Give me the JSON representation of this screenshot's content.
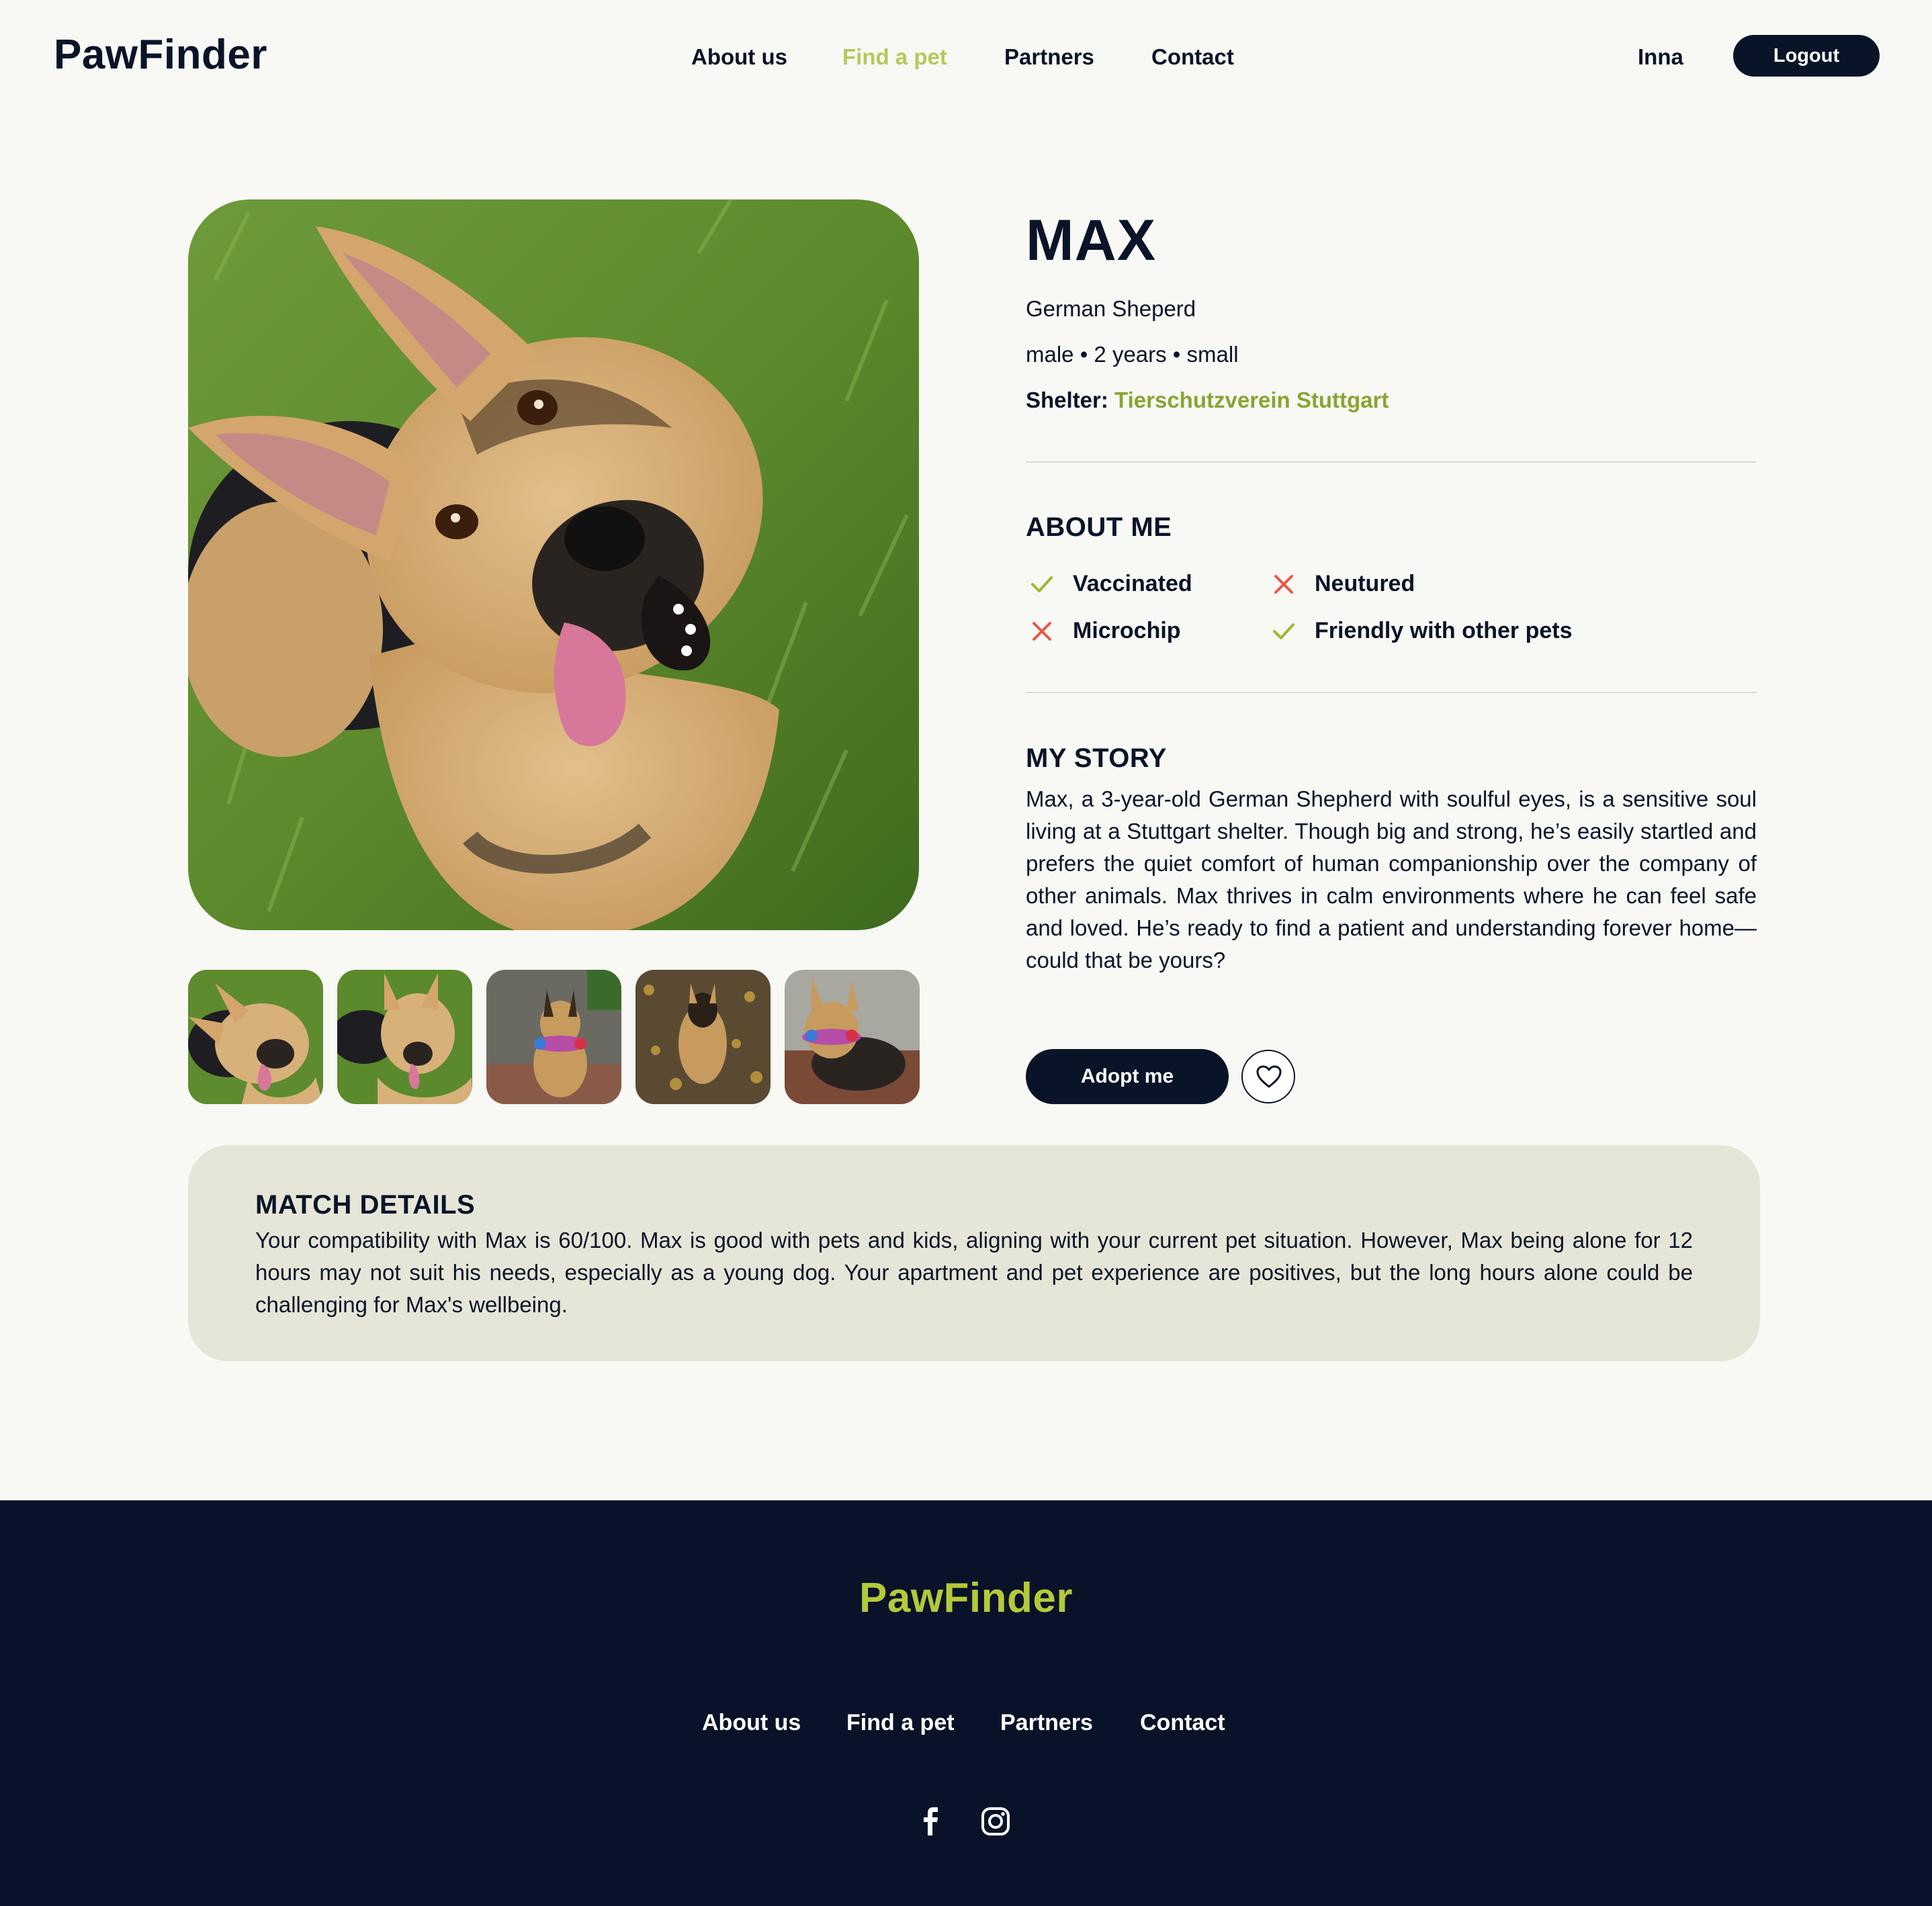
{
  "header": {
    "logo": "PawFinder",
    "nav": [
      {
        "label": "About us",
        "active": false
      },
      {
        "label": "Find a pet",
        "active": true
      },
      {
        "label": "Partners",
        "active": false
      },
      {
        "label": "Contact",
        "active": false
      }
    ],
    "user_name": "Inna",
    "logout_label": "Logout"
  },
  "gallery": {
    "main_photo_icon": "dog-photo",
    "thumbnail_count": 5
  },
  "pet": {
    "name": "MAX",
    "breed": "German Sheperd",
    "summary": "male • 2 years • small",
    "shelter_label": "Shelter:",
    "shelter_name": "Tierschutzverein Stuttgart"
  },
  "about": {
    "title": "ABOUT ME",
    "traits": [
      {
        "label": "Vaccinated",
        "status": "yes",
        "icon": "check-icon"
      },
      {
        "label": "Neutured",
        "status": "no",
        "icon": "cross-icon"
      },
      {
        "label": "Microchip",
        "status": "no",
        "icon": "cross-icon"
      },
      {
        "label": "Friendly with other pets",
        "status": "yes",
        "icon": "check-icon"
      }
    ]
  },
  "story": {
    "title": "MY STORY",
    "text": "Max, a 3-year-old German Shepherd with soulful eyes, is a sensitive soul living at a Stuttgart shelter. Though big and strong, he’s easily startled and prefers the quiet comfort of human companionship over the company of other animals. Max thrives in calm environments where he can feel safe and loved. He’s ready to find a patient and understanding forever home—could that be yours?"
  },
  "actions": {
    "adopt_label": "Adopt me",
    "favorite_icon": "heart-icon"
  },
  "match": {
    "title": "MATCH DETAILS",
    "text": "Your compatibility with Max is 60/100. Max is good with pets and kids, aligning with your current pet situation. However, Max being alone for 12 hours may not suit his needs, especially as a young dog. Your apartment and pet experience are positives, but the long hours alone could be challenging for Max's wellbeing."
  },
  "footer": {
    "logo": "PawFinder",
    "nav": [
      "About us",
      "Find a pet",
      "Partners",
      "Contact"
    ],
    "social_icons": [
      "facebook-icon",
      "instagram-icon"
    ]
  },
  "colors": {
    "navy": "#0a1428",
    "accent_green": "#b4c95a",
    "shelter_green": "#8aa432",
    "check_green": "#9bbb2e",
    "cross_red": "#e8574c",
    "card_bg": "#e6e6d8",
    "page_bg": "#f8f8f4"
  }
}
